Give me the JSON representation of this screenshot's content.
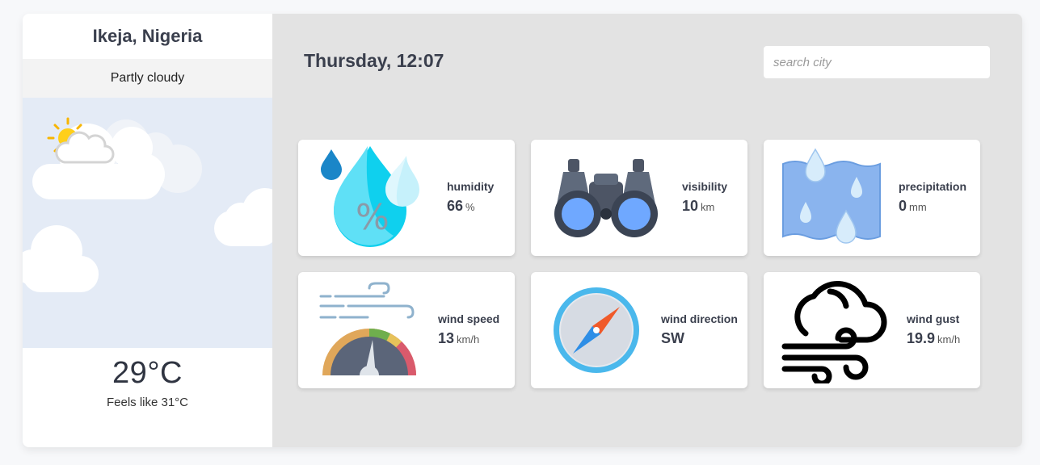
{
  "sidebar": {
    "city": "Ikeja, Nigeria",
    "condition": "Partly cloudy",
    "condition_icon": "partly-cloudy-icon",
    "temperature": "29°C",
    "feels_like": "Feels like 31°C"
  },
  "header": {
    "datetime": "Thursday, 12:07",
    "search": {
      "placeholder": "search city",
      "value": ""
    }
  },
  "cards": {
    "humidity": {
      "label": "humidity",
      "value": "66",
      "unit": "%",
      "icon": "humidity-drop-icon"
    },
    "visibility": {
      "label": "visibility",
      "value": "10",
      "unit": "km",
      "icon": "binoculars-icon"
    },
    "precipitation": {
      "label": "precipitation",
      "value": "0",
      "unit": "mm",
      "icon": "rain-icon"
    },
    "wind_speed": {
      "label": "wind speed",
      "value": "13",
      "unit": "km/h",
      "icon": "wind-gauge-icon"
    },
    "wind_direction": {
      "label": "wind direction",
      "value": "SW",
      "unit": "",
      "icon": "compass-icon"
    },
    "wind_gust": {
      "label": "wind gust",
      "value": "19.9",
      "unit": "km/h",
      "icon": "cloud-wind-icon"
    }
  },
  "colors": {
    "sky": "#e4ebf6",
    "main_bg": "#e3e3e3",
    "text": "#3a3f4d"
  }
}
